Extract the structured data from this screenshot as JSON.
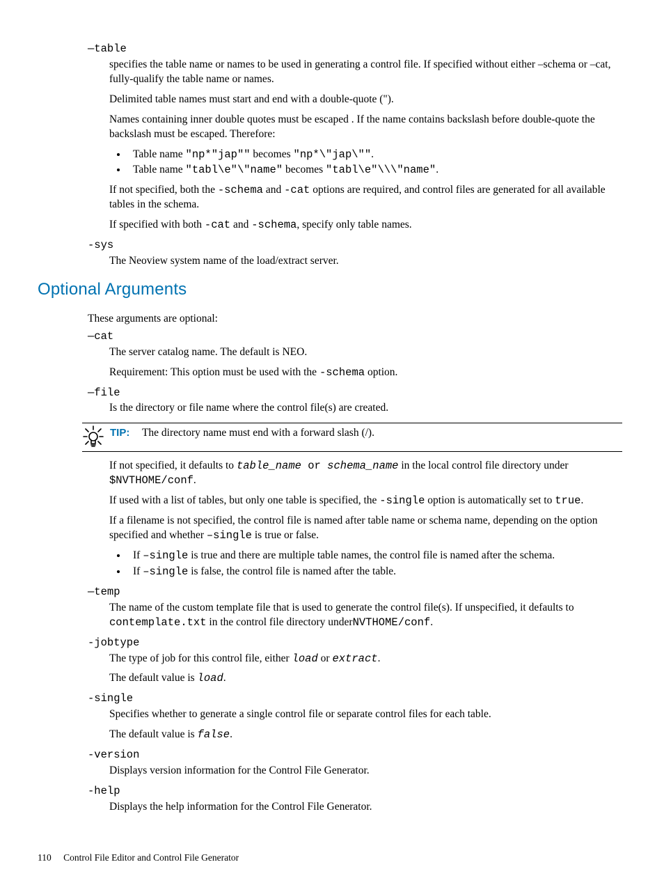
{
  "args_required": {
    "table": {
      "name": "—table",
      "p1_a": "specifies the table name or names to be used in generating a control file. If specified without either –schema or –cat, fully-qualify the table name or names.",
      "p2": "Delimited table names must start and end with a double-quote (\").",
      "p3": "Names containing inner double quotes must be escaped . If the name contains backslash before double-quote the backslash must be escaped. Therefore:",
      "li1_a": "Table name ",
      "li1_b": "\"np*\"jap\"\"",
      "li1_c": " becomes ",
      "li1_d": "\"np*\\\"jap\\\"\"",
      "li1_e": ".",
      "li2_a": "Table name ",
      "li2_b": "\"tabl\\e\"\\\"name\"",
      "li2_c": " becomes ",
      "li2_d": "\"tabl\\e\"\\\\\\\"name\"",
      "li2_e": ".",
      "p4_a": "If not specified, both the ",
      "p4_b": "-schema",
      "p4_c": " and ",
      "p4_d": "-cat",
      "p4_e": " options are required, and control files are generated for all available tables in the schema.",
      "p5_a": "If specified with both ",
      "p5_b": "-cat",
      "p5_c": " and ",
      "p5_d": "-schema",
      "p5_e": ", specify only table names."
    },
    "sys": {
      "name": "-sys",
      "p1": "The Neoview system name of the load/extract server."
    }
  },
  "section_title": "Optional Arguments",
  "section_intro": "These arguments are optional:",
  "args_optional": {
    "cat": {
      "name": "—cat",
      "p1": "The server catalog name. The default is NEO.",
      "p2_a": "Requirement: This option must be used with the ",
      "p2_b": "-schema",
      "p2_c": " option."
    },
    "file": {
      "name": "—file",
      "p1": "Is the directory or file name where the control file(s) are created."
    },
    "tip": {
      "label": "TIP:",
      "text": "The directory name must end with a forward slash (/)."
    },
    "file_cont": {
      "p1_a": "If not specified, it defaults to ",
      "p1_b": "table_name",
      "p1_c": " or ",
      "p1_d": "schema_name",
      "p1_e": "  in the local control file directory under ",
      "p1_f": "$NVTHOME/conf",
      "p1_g": ".",
      "p2_a": "If used with a list of tables, but only one table is specified, the ",
      "p2_b": "-single",
      "p2_c": " option is automatically set to ",
      "p2_d": "true",
      "p2_e": ".",
      "p3_a": "If a filename is not specified, the control file is named after table name or schema name, depending on the option specified and whether ",
      "p3_b": "–single",
      "p3_c": " is true or false.",
      "li1_a": "If ",
      "li1_b": "–single",
      "li1_c": " is true and there are multiple table names, the control file is named after the schema.",
      "li2_a": "If ",
      "li2_b": "–single",
      "li2_c": " is false, the control file is named after the table."
    },
    "temp": {
      "name": "—temp",
      "p1_a": "The name of the custom template file that is used to generate the control file(s). If unspecified, it defaults to ",
      "p1_b": "contemplate.txt",
      "p1_c": " in the control file directory under",
      "p1_d": "NVTHOME/conf",
      "p1_e": "."
    },
    "jobtype": {
      "name": "-jobtype",
      "p1_a": "The type of job for this control file, either ",
      "p1_b": "load",
      "p1_c": " or ",
      "p1_d": "extract",
      "p1_e": ".",
      "p2_a": "The default value is ",
      "p2_b": "load",
      "p2_c": "."
    },
    "single": {
      "name": "-single",
      "p1": "Specifies whether to generate a single control file or separate control files for each table.",
      "p2_a": "The default value is ",
      "p2_b": "false",
      "p2_c": "."
    },
    "version": {
      "name": "-version",
      "p1": "Displays version information for the Control File Generator."
    },
    "help": {
      "name": "-help",
      "p1": "Displays the help information for the Control File Generator."
    }
  },
  "footer": {
    "page_num": "110",
    "chapter": "Control File Editor and Control File Generator"
  }
}
